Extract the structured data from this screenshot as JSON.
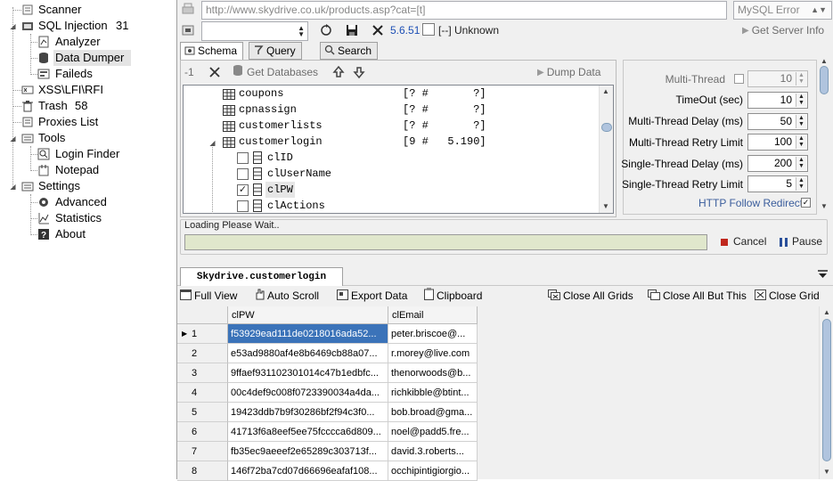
{
  "sidebar": {
    "items": [
      {
        "label": "Scanner",
        "count": "",
        "icon": "scanner-icon"
      },
      {
        "label": "SQL Injection",
        "count": "31",
        "icon": "sql-injection-icon"
      },
      {
        "label": "Analyzer",
        "count": "",
        "icon": "analyzer-icon"
      },
      {
        "label": "Data Dumper",
        "count": "",
        "icon": "database-icon"
      },
      {
        "label": "Faileds",
        "count": "",
        "icon": "failed-icon"
      },
      {
        "label": "XSS\\LFI\\RFI",
        "count": "",
        "icon": "xss-icon"
      },
      {
        "label": "Trash",
        "count": "58",
        "icon": "trash-icon"
      },
      {
        "label": "Proxies List",
        "count": "",
        "icon": "proxies-icon"
      },
      {
        "label": "Tools",
        "count": "",
        "icon": "tools-icon"
      },
      {
        "label": "Login Finder",
        "count": "",
        "icon": "login-finder-icon"
      },
      {
        "label": "Notepad",
        "count": "",
        "icon": "notepad-icon"
      },
      {
        "label": "Settings",
        "count": "",
        "icon": "settings-icon"
      },
      {
        "label": "Advanced",
        "count": "",
        "icon": "gear-icon"
      },
      {
        "label": "Statistics",
        "count": "",
        "icon": "statistics-icon"
      },
      {
        "label": "About",
        "count": "",
        "icon": "help-icon"
      }
    ]
  },
  "topbar": {
    "url": "http://www.skydrive.co.uk/products.asp?cat=[t]",
    "error_type": "MySQL Error",
    "version": "5.6.51",
    "dbms": "[--] Unknown",
    "get_server_info": "Get Server Info"
  },
  "tabs": [
    {
      "label": "Schema"
    },
    {
      "label": "Query"
    },
    {
      "label": "Search"
    }
  ],
  "schema_toolbar": {
    "count": "-1",
    "get_databases": "Get Databases",
    "dump_data": "Dump Data"
  },
  "schema_rows": [
    {
      "type": "table",
      "name": "coupons",
      "info": "[? #       ?]"
    },
    {
      "type": "table",
      "name": "cpnassign",
      "info": "[? #       ?]"
    },
    {
      "type": "table",
      "name": "customerlists",
      "info": "[? #       ?]"
    },
    {
      "type": "table",
      "name": "customerlogin",
      "info": "[9 #   5.190]"
    },
    {
      "type": "column",
      "name": "clID",
      "checked": false
    },
    {
      "type": "column",
      "name": "clUserName",
      "checked": false
    },
    {
      "type": "column",
      "name": "clPW",
      "checked": true
    },
    {
      "type": "column",
      "name": "clActions",
      "checked": false
    }
  ],
  "settings": [
    {
      "label": "Multi-Thread",
      "value": "10",
      "disabled": true
    },
    {
      "label": "TimeOut (sec)",
      "value": "10"
    },
    {
      "label": "Multi-Thread Delay  (ms)",
      "value": "50"
    },
    {
      "label": "Multi-Thread Retry Limit",
      "value": "100"
    },
    {
      "label": "Single-Thread Delay  (ms)",
      "value": "200"
    },
    {
      "label": "Single-Thread Retry Limit",
      "value": "5"
    }
  ],
  "http_follow_redirect": "HTTP Follow Redirect",
  "status": {
    "loading_text": "Loading Please Wait..",
    "cancel": "Cancel",
    "pause": "Pause"
  },
  "result_tab": {
    "label": "Skydrive.customerlogin"
  },
  "grid_toolbar": {
    "full_view": "Full View",
    "auto_scroll": "Auto Scroll",
    "export_data": "Export Data",
    "clipboard": "Clipboard",
    "close_all_grids": "Close All Grids",
    "close_all_but_this": "Close All But This",
    "close_grid": "Close Grid"
  },
  "grid": {
    "columns": [
      "clPW",
      "clEmail"
    ],
    "rows": [
      {
        "n": "1",
        "pw": "f53929ead111de0218016ada52...",
        "email": "peter.briscoe@..."
      },
      {
        "n": "2",
        "pw": "e53ad9880af4e8b6469cb88a07...",
        "email": "r.morey@live.com"
      },
      {
        "n": "3",
        "pw": "9ffaef931102301014c47b1edbfc...",
        "email": "thenorwoods@b..."
      },
      {
        "n": "4",
        "pw": "00c4def9c008f0723390034a4da...",
        "email": "richkibble@btint..."
      },
      {
        "n": "5",
        "pw": "19423ddb7b9f30286bf2f94c3f0...",
        "email": "bob.broad@gma..."
      },
      {
        "n": "6",
        "pw": "41713f6a8eef5ee75fcccca6d809...",
        "email": "noel@padd5.fre..."
      },
      {
        "n": "7",
        "pw": "fb35ec9aeeef2e65289c303713f...",
        "email": "david.3.roberts..."
      },
      {
        "n": "8",
        "pw": "146f72ba7cd07d66696eafaf108...",
        "email": "occhipintigiorgio..."
      }
    ]
  },
  "colors": {
    "selected_cell": "#3b73b9",
    "progress_bg": "#e0e7cc",
    "cancel_red": "#c0281e",
    "pause_blue": "#2a4f9a"
  }
}
